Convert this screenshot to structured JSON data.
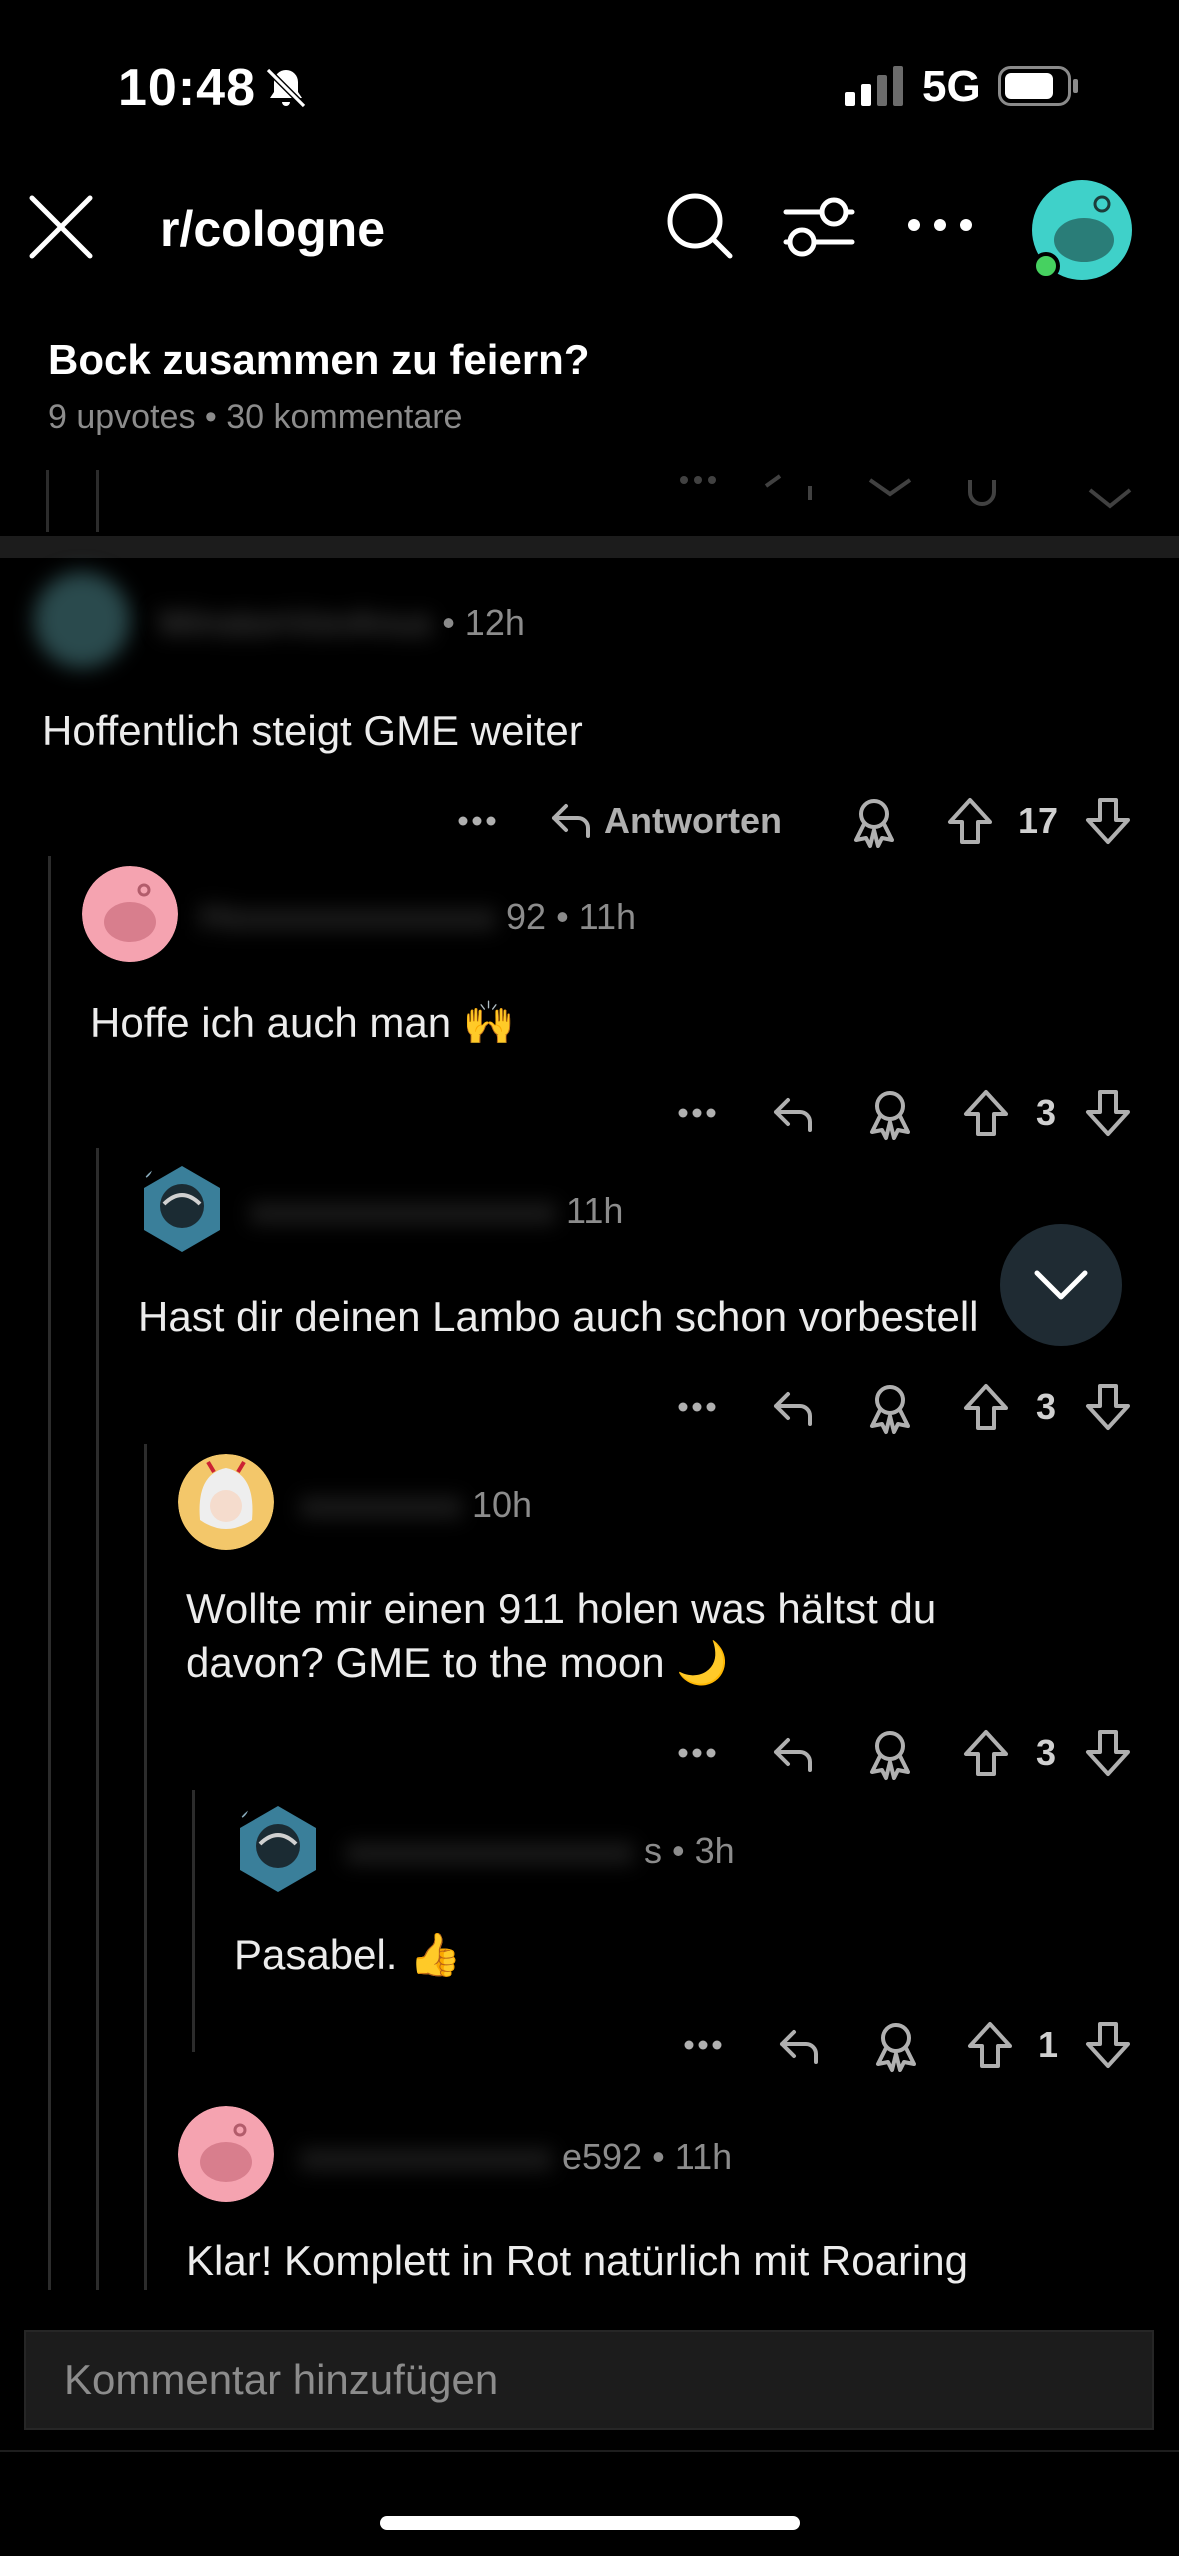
{
  "status": {
    "time": "10:48",
    "network": "5G"
  },
  "header": {
    "subreddit": "r/cologne"
  },
  "post": {
    "title": "Bock zusammen zu feiern?",
    "meta": "9 upvotes • 30 kommentare"
  },
  "labels": {
    "reply": "Antworten"
  },
  "comments": [
    {
      "user": "WinstonVonAnus",
      "time": "• 12h",
      "text": "Hoffentlich steigt GME weiter",
      "votes": "17"
    },
    {
      "user": "92",
      "time": "• 11h",
      "text": "Hoffe ich auch man 🙌",
      "votes": "3"
    },
    {
      "user": "",
      "time": "11h",
      "text": "Hast dir deinen Lambo auch schon vorbestell",
      "votes": "3"
    },
    {
      "user": "",
      "time": "10h",
      "text": "Wollte mir einen 911 holen was hältst du",
      "text2": "davon? GME to the moon 🌙",
      "votes": "3"
    },
    {
      "user": "s",
      "time": "• 3h",
      "text": "Pasabel. 👍",
      "votes": "1"
    },
    {
      "user": "e592",
      "time": "• 11h",
      "text": "Klar! Komplett in Rot natürlich mit Roaring",
      "votes": ""
    }
  ],
  "composer": {
    "placeholder": "Kommentar hinzufügen"
  },
  "colors": {
    "background": "#000000",
    "accent_teal": "#3fd1c9",
    "online": "#46d160",
    "avatar_pink": "#f5a3b0"
  }
}
